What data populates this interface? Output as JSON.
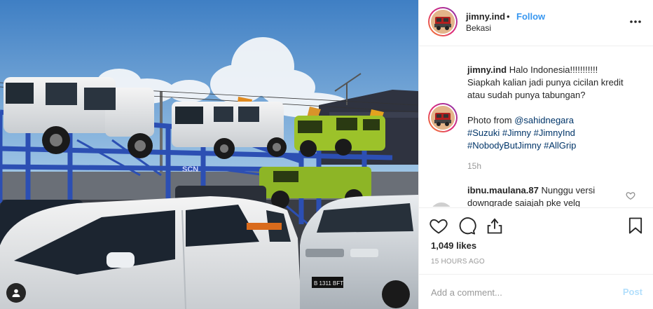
{
  "post": {
    "username": "jimny.ind",
    "separator": "•",
    "follow_label": "Follow",
    "location": "Bekasi",
    "more_icon": "more-horizontal-icon"
  },
  "caption": {
    "username": "jimny.ind",
    "line1": "Halo Indonesia!!!!!!!!!!!",
    "line2": "Siapkah kalian jadi punya cicilan kredit",
    "line3": "atau sudah punya tabungan?",
    "photo_from": "Photo from",
    "mention": "@sahidnegara",
    "hashtags_line1": "#Suzuki #Jimny #JimnyInd",
    "hashtags_line2": "#NobodyButJimny #AllGrip",
    "time": "15h"
  },
  "comment": {
    "username": "ibnu.maulana.87",
    "text": "Nunggu versi downgrade saiajah pke velg"
  },
  "actions": {
    "like_icon": "heart-icon",
    "comment_icon": "comment-bubble-icon",
    "share_icon": "share-icon",
    "save_icon": "bookmark-icon",
    "likes": "1,049 likes",
    "posted_ago": "15 HOURS AGO"
  },
  "composer": {
    "placeholder": "Add a comment...",
    "post_label": "Post"
  },
  "photo": {
    "plate_text": "B 1311 BFT",
    "truck_label": "SCN",
    "tag_icon": "user-tag-icon"
  },
  "colors": {
    "link": "#3897f0",
    "hashtag": "#003569",
    "muted": "#999999",
    "post_disabled": "#b2dffc"
  }
}
